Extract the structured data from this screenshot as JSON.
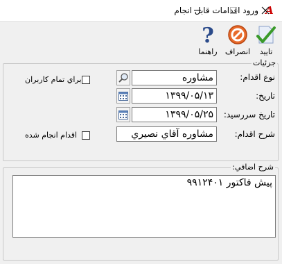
{
  "window": {
    "title": "ورود اقدامات قابل انجام",
    "app_icon_glyph": "A"
  },
  "toolbar": {
    "confirm_label": "تاييد",
    "cancel_label": "انصراف",
    "help_label": "راهنما"
  },
  "details": {
    "group_label": "جزئيات",
    "action_type": {
      "label": "نوع اقدام:",
      "value": "مشاوره"
    },
    "date": {
      "label": "تاريخ:",
      "value": "۱۳۹۹/۰۵/۱۳"
    },
    "due_date": {
      "label": "تاريخ سررسيد:",
      "value": "۱۳۹۹/۰۵/۲۵"
    },
    "description": {
      "label": "شرح اقدام:",
      "value": "مشاوره آقاي نصيري"
    },
    "all_users": {
      "label": "براي تمام كاربران",
      "checked": false
    },
    "done": {
      "label": "اقدام انجام شده",
      "checked": false
    }
  },
  "extra": {
    "group_label": "شرح اضافي:",
    "text": "پيش فاكتور ۹۹۱۲۴۰۱"
  },
  "icons": {
    "close": "close-icon",
    "minimize": "minimize-icon",
    "maximize": "maximize-icon",
    "confirm": "checkmark-icon",
    "cancel": "stop-icon",
    "help": "question-icon",
    "lookup": "magnifier-icon",
    "calendar": "calendar-icon"
  },
  "colors": {
    "confirm_check": "#3a9a2a",
    "cancel_circle": "#e05a1c",
    "help_question": "#2a4a8a",
    "app_icon": "#cc0000"
  }
}
